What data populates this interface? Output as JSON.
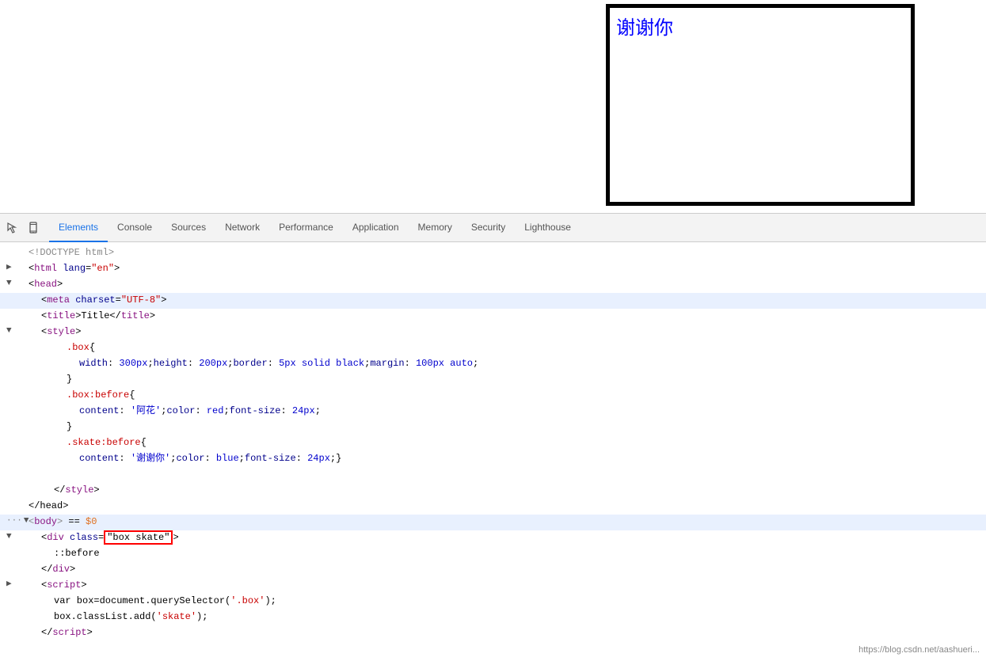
{
  "preview": {
    "box_text": "谢谢你"
  },
  "devtools": {
    "tabs": [
      {
        "label": "Elements",
        "active": true
      },
      {
        "label": "Console",
        "active": false
      },
      {
        "label": "Sources",
        "active": false
      },
      {
        "label": "Network",
        "active": false
      },
      {
        "label": "Performance",
        "active": false
      },
      {
        "label": "Application",
        "active": false
      },
      {
        "label": "Memory",
        "active": false
      },
      {
        "label": "Security",
        "active": false
      },
      {
        "label": "Lighthouse",
        "active": false
      }
    ]
  },
  "code": {
    "lines": [
      {
        "indent": 0,
        "html": "<!DOCTYPE html>",
        "class": "c-gray"
      },
      {
        "indent": 0,
        "html": "&lt;html lang=<span class='c-red'>\"en\"</span>&gt;"
      },
      {
        "indent": 0,
        "expand": "▼",
        "html": "&lt;head&gt;"
      },
      {
        "indent": 1,
        "expand": " ",
        "highlight_meta": true,
        "html": "&lt;<span class='c-purple'>meta</span> <span class='c-darkblue'>charset</span>=<span class='c-red'>\"UTF-8\"</span>&gt;"
      },
      {
        "indent": 1,
        "html": "&lt;<span class='c-purple'>title</span>&gt;Title&lt;/<span class='c-purple'>title</span>&gt;"
      },
      {
        "indent": 1,
        "expand": "▼",
        "html": "&lt;<span class='c-purple'>style</span>&gt;"
      },
      {
        "indent": 3,
        "html": "<span class='c-red'>.box</span>{"
      },
      {
        "indent": 4,
        "html": "<span class='c-darkblue'>width</span>: <span class='c-blue'>300px</span>;<span class='c-darkblue'>height</span>: <span class='c-blue'>200px</span>;<span class='c-darkblue'>border</span>: <span class='c-blue'>5px solid black</span>;<span class='c-darkblue'>margin</span>: <span class='c-blue'>100px auto</span>;"
      },
      {
        "indent": 3,
        "html": "}"
      },
      {
        "indent": 3,
        "html": "<span class='c-red'>.box:before</span>{"
      },
      {
        "indent": 4,
        "html": "<span class='c-darkblue'>content</span>: <span class='c-blue'>'阿花'</span>;<span class='c-darkblue'>color</span>: <span class='c-blue'>red</span>;<span class='c-darkblue'>font-size</span>: <span class='c-blue'>24px</span>;"
      },
      {
        "indent": 3,
        "html": "}"
      },
      {
        "indent": 3,
        "html": "<span class='c-red'>.skate:before</span>{"
      },
      {
        "indent": 4,
        "html": "<span class='c-darkblue'>content</span>: <span class='c-blue'>'谢谢你'</span>;<span class='c-darkblue'>color</span>: <span class='c-blue'>blue</span>;<span class='c-darkblue'>font-size</span>: <span class='c-blue'>24px</span>;}"
      },
      {
        "indent": 0,
        "html": ""
      },
      {
        "indent": 1,
        "html": "&lt;/<span class='c-purple'>style</span>&gt;"
      },
      {
        "indent": 0,
        "html": "&lt;/head&gt;"
      },
      {
        "indent": 0,
        "expand": "▼",
        "highlighted": true,
        "html": "<span class='c-gray'>...</span> &lt;<span class='c-purple'>body</span>&gt; == <span class='c-orange'>$0</span>"
      },
      {
        "indent": 1,
        "expand": "▼",
        "html": "&lt;<span class='c-purple'>div</span> class=<span class='highlight_class'>\"box skate\"</span>&gt;"
      },
      {
        "indent": 2,
        "html": "::before"
      },
      {
        "indent": 1,
        "html": "&lt;/<span class='c-purple'>div</span>&gt;"
      },
      {
        "indent": 1,
        "expand": " ",
        "html": "&lt;<span class='c-purple'>script</span>&gt;"
      },
      {
        "indent": 2,
        "html": "var box=document.querySelector(<span class='c-red'>'.box'</span>);"
      },
      {
        "indent": 2,
        "html": "box.classList.add(<span class='c-red'>'skate'</span>);"
      },
      {
        "indent": 1,
        "html": "&lt;/<span class='c-purple'>script</span>&gt;"
      }
    ]
  },
  "status_bar": {
    "url": "https://blog.csdn.net/aashueri..."
  }
}
